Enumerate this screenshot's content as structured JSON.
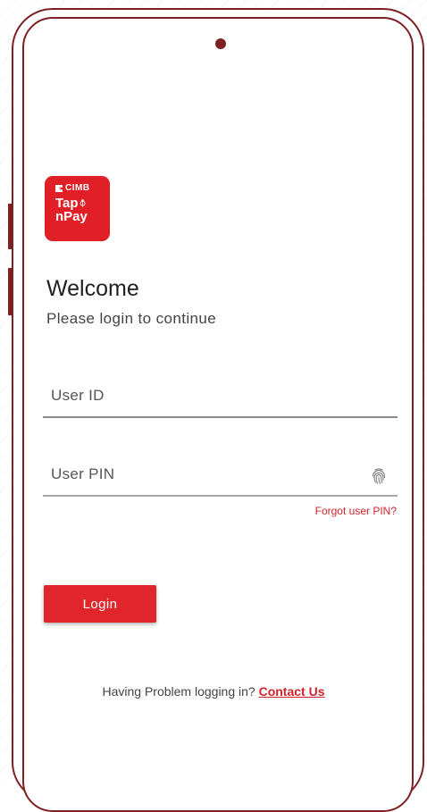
{
  "brand": {
    "logo_top": "CIMB",
    "logo_tap": "Tap",
    "logo_pay": "nPay",
    "accent_color": "#e0262b",
    "frame_color": "#7d2024"
  },
  "login": {
    "title": "Welcome",
    "subtitle": "Please login to continue",
    "user_id_placeholder": "User ID",
    "user_pin_placeholder": "User PIN",
    "fingerprint_icon": "fingerprint-icon",
    "forgot_pin": "Forgot user PIN?",
    "login_button": "Login",
    "help_text": "Having Problem logging in?",
    "contact_link": "Contact Us"
  }
}
